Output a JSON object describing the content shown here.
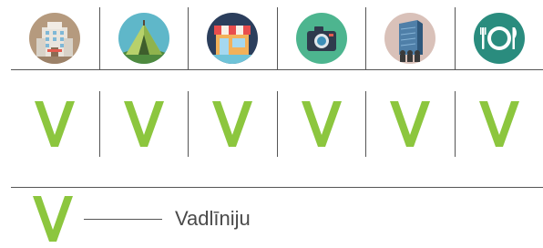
{
  "colors": {
    "check_green": "#8cc63e",
    "rule_gray": "#555555",
    "text_gray": "#4a4a4a"
  },
  "header_icons": [
    {
      "name": "hotel-building-icon",
      "bg": "#b59a7e"
    },
    {
      "name": "camping-tent-icon",
      "bg": "#5fb7c9"
    },
    {
      "name": "shop-storefront-icon",
      "bg": "#2b3e5c"
    },
    {
      "name": "camera-icon",
      "bg": "#4db58f"
    },
    {
      "name": "office-tower-icon",
      "bg": "#d9c1b9"
    },
    {
      "name": "restaurant-plate-icon",
      "bg": "#2a8c7e"
    }
  ],
  "row_marks": [
    "V",
    "V",
    "V",
    "V",
    "V",
    "V"
  ],
  "legend": {
    "mark": "V",
    "label": "Vadlīniju"
  }
}
